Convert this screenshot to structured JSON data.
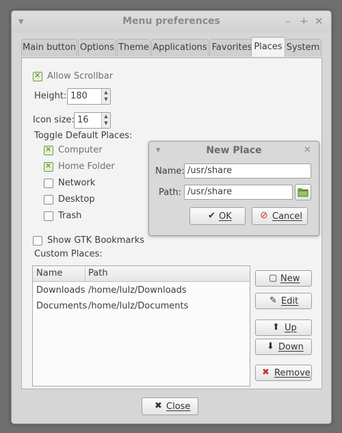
{
  "window": {
    "title": "Menu preferences",
    "menu_glyph": "▾",
    "minimize_glyph": "–",
    "maximize_glyph": "+",
    "close_glyph": "✕"
  },
  "tabs": [
    {
      "label": "Main button"
    },
    {
      "label": "Options"
    },
    {
      "label": "Theme"
    },
    {
      "label": "Applications"
    },
    {
      "label": "Favorites"
    },
    {
      "label": "Places",
      "active": true
    },
    {
      "label": "System"
    }
  ],
  "places": {
    "allow_scrollbar": {
      "label": "Allow Scrollbar",
      "checked": true
    },
    "height": {
      "label": "Height:",
      "value": "180"
    },
    "icon_size": {
      "label": "Icon size:",
      "value": "16"
    },
    "toggle_label": "Toggle Default Places:",
    "defaults": [
      {
        "label": "Computer",
        "checked": true
      },
      {
        "label": "Home Folder",
        "checked": true
      },
      {
        "label": "Network",
        "checked": false
      },
      {
        "label": "Desktop",
        "checked": false
      },
      {
        "label": "Trash",
        "checked": false
      }
    ],
    "show_gtk": {
      "label": "Show GTK Bookmarks",
      "checked": false
    },
    "custom_label": "Custom Places:",
    "columns": [
      "Name",
      "Path"
    ],
    "rows": [
      {
        "name": "Downloads",
        "path": "/home/lulz/Downloads"
      },
      {
        "name": "Documents",
        "path": "/home/lulz/Documents"
      }
    ],
    "buttons": {
      "new": "New",
      "edit": "Edit",
      "up": "Up",
      "down": "Down",
      "remove": "Remove"
    },
    "close": "Close"
  },
  "dialog": {
    "title": "New Place",
    "name_label": "Name:",
    "name_value": "/usr/share",
    "path_label": "Path:",
    "path_value": "/usr/share",
    "ok": "OK",
    "cancel": "Cancel"
  },
  "colors": {
    "check_green": "#4c8a20",
    "cancel_red": "#c0392b",
    "folder_green": "#7cae4a"
  }
}
